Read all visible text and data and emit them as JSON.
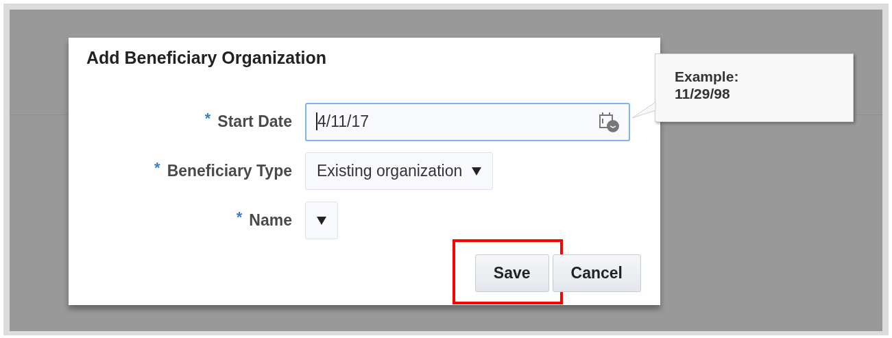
{
  "dialog": {
    "title": "Add Beneficiary Organization",
    "fields": [
      {
        "kind": "date",
        "required_mark": "*",
        "label": "Start Date",
        "value": "4/11/17",
        "focused": true
      },
      {
        "kind": "select",
        "required_mark": "*",
        "label": "Beneficiary Type",
        "value": "Existing organization",
        "focused": false
      },
      {
        "kind": "select",
        "required_mark": "*",
        "label": "Name",
        "focused": false
      }
    ],
    "buttons": [
      {
        "label": "Save",
        "highlighted": true
      },
      {
        "label": "Cancel",
        "highlighted": false
      }
    ]
  },
  "tooltip": {
    "lines": [
      "Example:",
      "11/29/98"
    ]
  }
}
